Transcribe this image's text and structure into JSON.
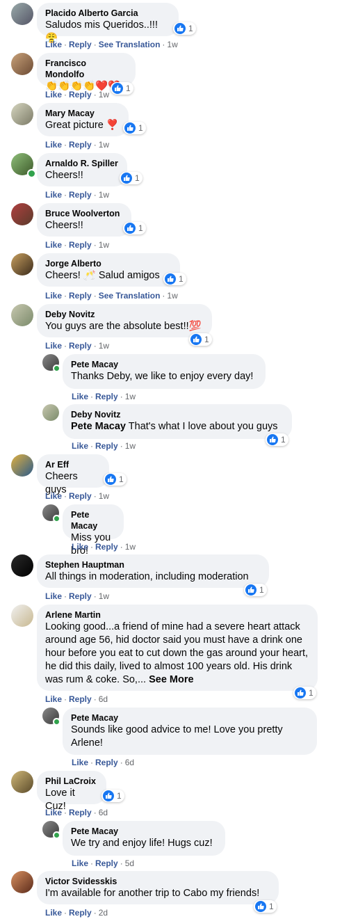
{
  "comments": [
    {
      "author": "Placido Alberto Garcia",
      "text": "Saludos mis Queridos..!!!😤",
      "likes": "Like",
      "reply": "Reply",
      "extra": "See Translation",
      "time": "1w",
      "count": "1"
    },
    {
      "author": "Francisco Mondolfo",
      "text": "👏👏👏👏❤️❤️",
      "likes": "Like",
      "reply": "Reply",
      "time": "1w",
      "count": "1"
    },
    {
      "author": "Mary Macay",
      "text": "Great picture ❣️",
      "likes": "Like",
      "reply": "Reply",
      "time": "1w",
      "count": "1"
    },
    {
      "author": "Arnaldo R. Spiller",
      "text": "Cheers!!",
      "likes": "Like",
      "reply": "Reply",
      "time": "1w",
      "count": "1"
    },
    {
      "author": "Bruce Woolverton",
      "text": "Cheers!!",
      "likes": "Like",
      "reply": "Reply",
      "time": "1w",
      "count": "1"
    },
    {
      "author": "Jorge Alberto",
      "text": "Cheers! 🥂 Salud amigos",
      "likes": "Like",
      "reply": "Reply",
      "extra": "See Translation",
      "time": "1w",
      "count": "1"
    },
    {
      "author": "Deby Novitz",
      "text": "You guys are the absolute best!!💯",
      "likes": "Like",
      "reply": "Reply",
      "time": "1w",
      "count": "1"
    },
    {
      "author": "Pete Macay",
      "text": "Thanks Deby, we like to enjoy every day!",
      "likes": "Like",
      "reply": "Reply",
      "time": "1w"
    },
    {
      "author": "Deby Novitz",
      "mention": "Pete Macay",
      "text": "That's what I love about you guys",
      "likes": "Like",
      "reply": "Reply",
      "time": "1w",
      "count": "1"
    },
    {
      "author": "Ar Eff",
      "text": "Cheers guys",
      "likes": "Like",
      "reply": "Reply",
      "time": "1w",
      "count": "1"
    },
    {
      "author": "Pete Macay",
      "text": "Miss you bro!",
      "likes": "Like",
      "reply": "Reply",
      "time": "1w"
    },
    {
      "author": "Stephen Hauptman",
      "text": "All things in moderation, including moderation",
      "likes": "Like",
      "reply": "Reply",
      "time": "1w",
      "count": "1"
    },
    {
      "author": "Arlene Martin",
      "text": "Looking good...a friend of mine had a severe heart attack around age 56, hid doctor said you must have a drink one hour before you eat to cut down the gas around your heart, he did this daily, lived to almost 100 years old. His drink was rum & coke. So,...",
      "see_more": "See More",
      "likes": "Like",
      "reply": "Reply",
      "time": "6d",
      "count": "1"
    },
    {
      "author": "Pete Macay",
      "text": "Sounds like good advice to me! Love you pretty Arlene!",
      "likes": "Like",
      "reply": "Reply",
      "time": "6d"
    },
    {
      "author": "Phil LaCroix",
      "text": "Love it Cuz!",
      "likes": "Like",
      "reply": "Reply",
      "time": "6d",
      "count": "1"
    },
    {
      "author": "Pete Macay",
      "text": "We try and enjoy life! Hugs cuz!",
      "likes": "Like",
      "reply": "Reply",
      "time": "5d"
    },
    {
      "author": "Victor Svidesskis",
      "text": "I'm available for another trip to Cabo my friends!",
      "likes": "Like",
      "reply": "Reply",
      "time": "2d",
      "count": "1"
    }
  ],
  "colors": {
    "bubble": "#f0f2f5",
    "link": "#385898",
    "like": "#1877f2",
    "online": "#31a24c"
  }
}
